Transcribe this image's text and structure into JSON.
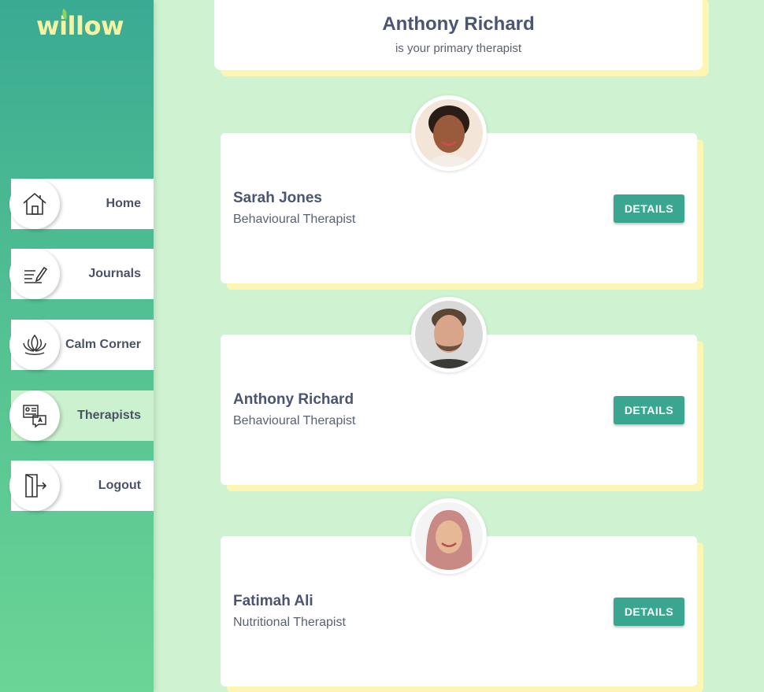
{
  "app": {
    "logo": "willow"
  },
  "sidebar": {
    "items": [
      {
        "label": "Home",
        "icon": "home-icon"
      },
      {
        "label": "Journals",
        "icon": "journal-pen-icon"
      },
      {
        "label": "Calm Corner",
        "icon": "lotus-icon"
      },
      {
        "label": "Therapists",
        "icon": "therapist-chat-icon",
        "active": true
      },
      {
        "label": "Logout",
        "icon": "logout-door-icon"
      }
    ]
  },
  "primary": {
    "name": "Anthony Richard",
    "subtitle": "is your primary therapist"
  },
  "therapists": [
    {
      "name": "Sarah Jones",
      "role": "Behavioural Therapist",
      "button": "DETAILS"
    },
    {
      "name": "Anthony Richard",
      "role": "Behavioural Therapist",
      "button": "DETAILS"
    },
    {
      "name": "Fatimah Ali",
      "role": "Nutritional Therapist",
      "button": "DETAILS"
    }
  ],
  "colors": {
    "sidebar_top": "#3aaa93",
    "sidebar_bottom": "#6bd595",
    "background": "#cff3d1",
    "accent_button": "#3aa68f",
    "card_shadow": "#fdf5b3"
  }
}
